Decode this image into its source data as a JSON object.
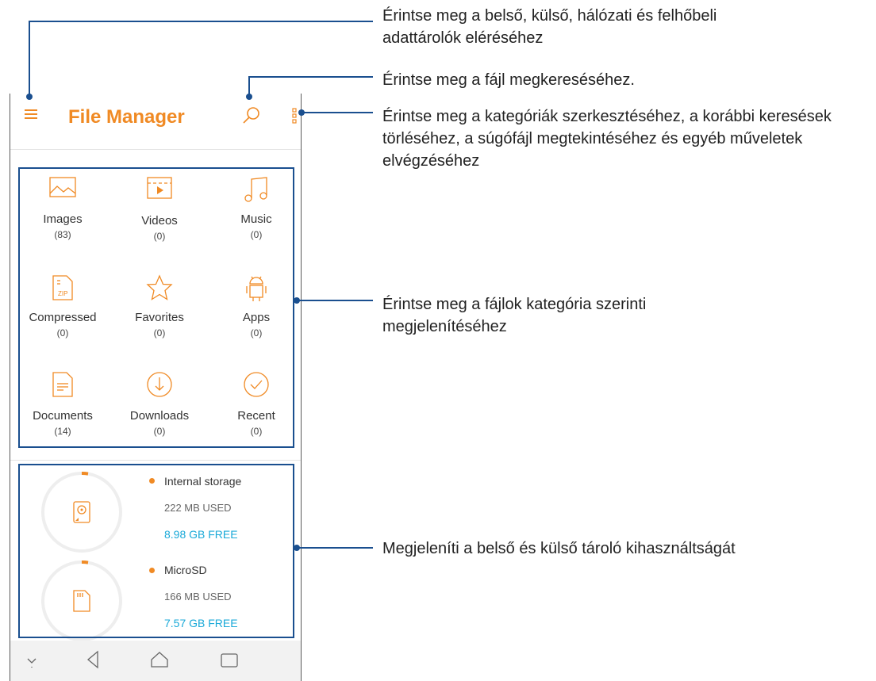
{
  "app": {
    "title": "File Manager"
  },
  "categories": [
    {
      "label": "Images",
      "count": "(83)",
      "icon": "image-icon"
    },
    {
      "label": "Videos",
      "count": "(0)",
      "icon": "video-icon"
    },
    {
      "label": "Music",
      "count": "(0)",
      "icon": "music-icon"
    },
    {
      "label": "Compressed",
      "count": "(0)",
      "icon": "zip-icon"
    },
    {
      "label": "Favorites",
      "count": "(0)",
      "icon": "star-icon"
    },
    {
      "label": "Apps",
      "count": "(0)",
      "icon": "android-icon"
    },
    {
      "label": "Documents",
      "count": "(14)",
      "icon": "document-icon"
    },
    {
      "label": "Downloads",
      "count": "(0)",
      "icon": "download-icon"
    },
    {
      "label": "Recent",
      "count": "(0)",
      "icon": "check-circle-icon"
    }
  ],
  "storage": [
    {
      "name": "Internal storage",
      "used": "222 MB USED",
      "free": "8.98 GB FREE",
      "icon": "hard-drive-icon"
    },
    {
      "name": "MicroSD",
      "used": "166 MB USED",
      "free": "7.57 GB FREE",
      "icon": "sd-card-icon"
    }
  ],
  "annotations": {
    "menu": "Érintse meg a belső, külső, hálózati és felhőbeli adattárolók eléréséhez",
    "search": "Érintse meg a fájl megkereséséhez.",
    "more": "Érintse meg a kategóriák szerkesztéséhez, a korábbi keresések törléséhez, a súgófájl megtekintéséhez és egyéb műveletek elvégzéséhez",
    "categories": "Érintse meg a fájlok kategória szerinti megjelenítéséhez",
    "storage": "Megjeleníti a belső és külső tároló kihasználtságát"
  },
  "colors": {
    "accent": "#f08a24",
    "free": "#1aa9d8",
    "annotation": "#1a4f8f"
  }
}
